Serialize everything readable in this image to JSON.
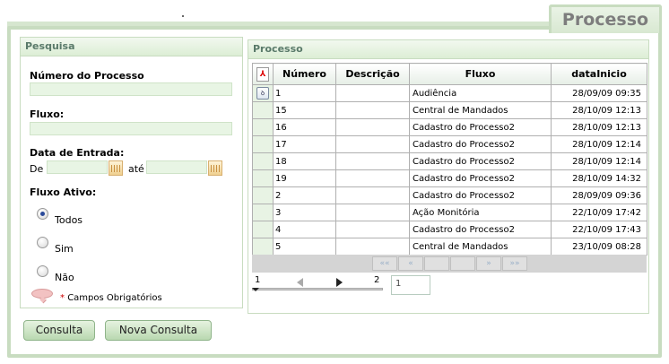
{
  "title": "Processo",
  "search": {
    "header": "Pesquisa",
    "numero_label": "Número do Processo",
    "numero_value": "",
    "fluxo_label": "Fluxo:",
    "fluxo_value": "",
    "data_label": "Data de Entrada:",
    "de_label": "De",
    "ate_label": "até",
    "de_value": "",
    "ate_value": "",
    "fluxo_ativo_label": "Fluxo Ativo:",
    "radios": [
      {
        "label": "Todos",
        "checked": true
      },
      {
        "label": "Sim",
        "checked": false
      },
      {
        "label": "Não",
        "checked": false
      }
    ],
    "required_star": "*",
    "required_text": "Campos Obrigatórios"
  },
  "buttons": {
    "consulta": "Consulta",
    "nova_consulta": "Nova Consulta"
  },
  "results": {
    "header": "Processo",
    "columns": [
      "Número",
      "Descrição",
      "Fluxo",
      "dataInicio"
    ],
    "rows": [
      {
        "numero": "1",
        "descricao": "",
        "fluxo": "Audiência",
        "data": "28/09/09 09:35"
      },
      {
        "numero": "15",
        "descricao": "",
        "fluxo": "Central de Mandados",
        "data": "28/10/09 12:13"
      },
      {
        "numero": "16",
        "descricao": "",
        "fluxo": "Cadastro do Processo2",
        "data": "28/10/09 12:13"
      },
      {
        "numero": "17",
        "descricao": "",
        "fluxo": "Cadastro do Processo2",
        "data": "28/10/09 12:14"
      },
      {
        "numero": "18",
        "descricao": "",
        "fluxo": "Cadastro do Processo2",
        "data": "28/10/09 12:14"
      },
      {
        "numero": "19",
        "descricao": "",
        "fluxo": "Cadastro do Processo2",
        "data": "28/10/09 14:32"
      },
      {
        "numero": "2",
        "descricao": "",
        "fluxo": "Cadastro do Processo2",
        "data": "28/09/09 09:36"
      },
      {
        "numero": "3",
        "descricao": "",
        "fluxo": "Ação Monitória",
        "data": "22/10/09 17:42"
      },
      {
        "numero": "4",
        "descricao": "",
        "fluxo": "Cadastro do Processo2",
        "data": "22/10/09 17:43"
      },
      {
        "numero": "5",
        "descricao": "",
        "fluxo": "Central de Mandados",
        "data": "23/10/09 08:28"
      }
    ],
    "pager": {
      "first": "««",
      "prev": "«",
      "next": "»",
      "last": "»»"
    },
    "scroller": {
      "start": "1",
      "end": "2"
    },
    "page_value": "1"
  },
  "icons": {
    "pdf": "pdf-icon",
    "row": "document-icon",
    "calendar": "calendar-icon",
    "required": "speech-bubble-icon"
  },
  "colors": {
    "border": "#c8dcc0",
    "header_text": "#5a7a6a",
    "input_bg": "#e8f5e4",
    "required_star": "#cc0000"
  }
}
